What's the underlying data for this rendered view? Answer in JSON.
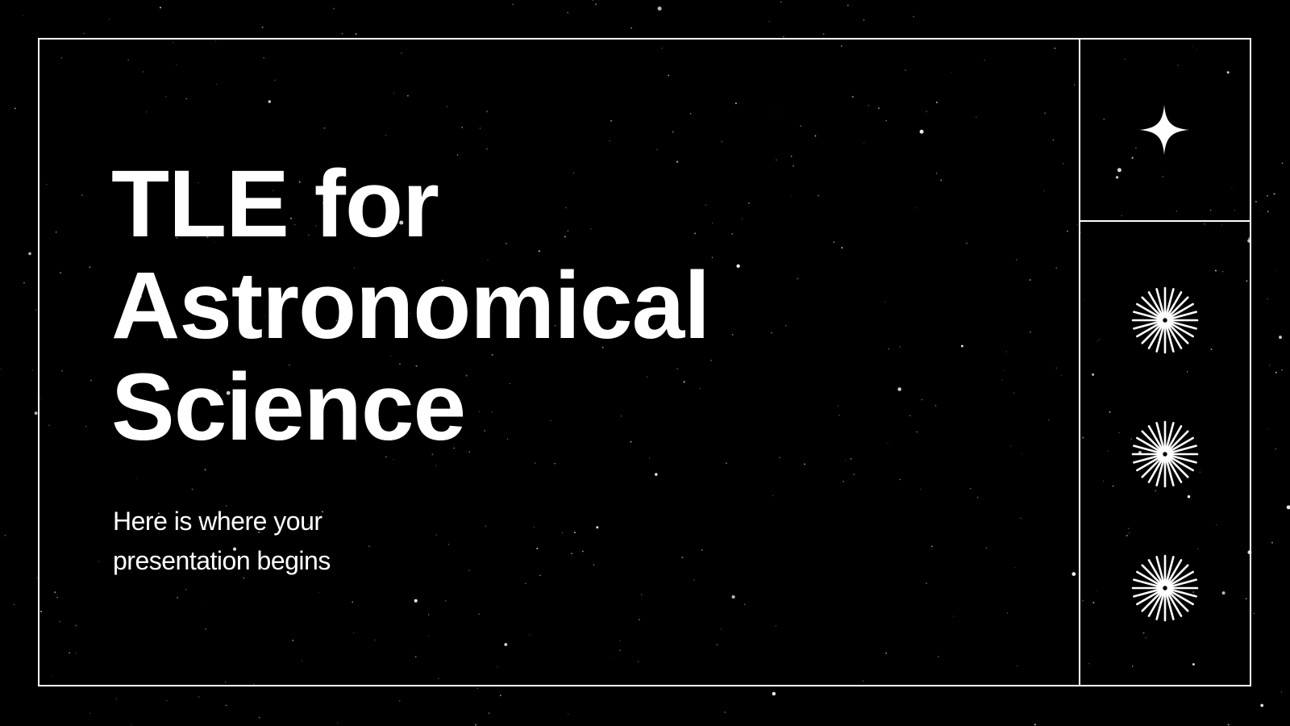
{
  "slide": {
    "title_lines": [
      "TLE for",
      "Astronomical",
      "Science"
    ],
    "subtitle_lines": [
      "Here is where your",
      "presentation begins"
    ]
  },
  "decorations": {
    "top_icon": "four-point-star-icon",
    "side_icons": [
      "starburst-icon",
      "starburst-icon",
      "starburst-icon"
    ],
    "background": "starfield",
    "colors": {
      "background": "#000000",
      "foreground": "#ffffff"
    }
  }
}
